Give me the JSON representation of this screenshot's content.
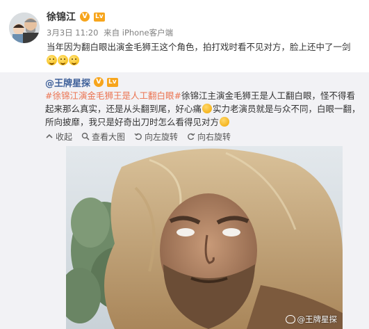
{
  "post": {
    "author": "徐锦江",
    "timestamp": "3月3日 11:20",
    "source": "来自 iPhone客户端",
    "text": "当年因为翻白眼出演金毛狮王这个角色，拍打戏时看不见对方，脸上还中了一剑",
    "emoji_icons": [
      "laugh-cry-emoji",
      "laugh-cry-emoji",
      "laugh-cry-emoji"
    ]
  },
  "repost": {
    "author": "@王牌星探",
    "hashtag": "#徐锦江演金毛狮王是人工翻白眼#",
    "text_part1": "徐锦江主演金毛狮王是人工翻白眼，怪不得看起来那么真实，还是从头翻到尾，好心痛",
    "text_part2": "实力老演员就是与众不同，白眼一翻，所向披靡，我只是好奇出刀时怎么看得见对方",
    "toolbar": {
      "collapse": "收起",
      "view_large": "查看大图",
      "rotate_left": "向左旋转",
      "rotate_right": "向右旋转"
    },
    "watermark": "@王牌星探"
  },
  "colors": {
    "hashtag": "#eb7350",
    "repost_author": "#3d5f99",
    "repost_background": "#f2f2f5",
    "badge": "#f7a51c"
  },
  "icons": {
    "verified": "verified-icon",
    "level": "level-icon",
    "collapse": "collapse-icon",
    "zoom": "magnifier-icon",
    "rotate_left": "rotate-left-icon",
    "rotate_right": "rotate-right-icon",
    "weibo_logo": "weibo-logo-icon"
  }
}
